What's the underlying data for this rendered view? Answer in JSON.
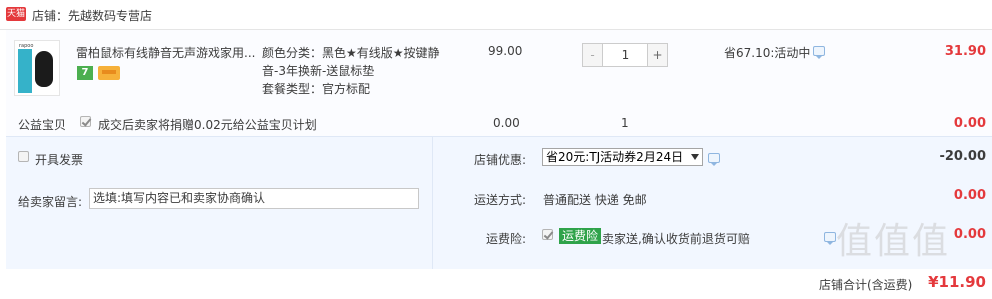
{
  "shop": {
    "badge": "天猫",
    "name": "店铺：先越数码专营店"
  },
  "item": {
    "title": "雷柏鼠标有线静音无声游戏家用...",
    "thumb_brand": "rapoo",
    "sku_lines": [
      "颜色分类：黑色★有线版★按键静",
      "音-3年换新-送鼠标垫",
      "套餐类型：官方标配"
    ],
    "unit_price": "99.00",
    "quantity": "1",
    "qty_minus": "-",
    "qty_plus": "+",
    "promo": "省67.10:活动中",
    "subtotal": "31.90"
  },
  "welfare": {
    "label": "公益宝贝",
    "text": "成交后卖家将捐赠0.02元给公益宝贝计划",
    "price": "0.00",
    "qty": "1",
    "total": "0.00"
  },
  "invoice": {
    "label": "开具发票"
  },
  "discount": {
    "label": "店铺优惠:",
    "selected": "省20元:TJ活动券2月24日",
    "amount": "-20.00"
  },
  "message": {
    "label": "给卖家留言:",
    "placeholder": "选填:填写内容已和卖家协商确认"
  },
  "shipping": {
    "label": "运送方式:",
    "value": "普通配送 快递 免邮",
    "cost": "0.00"
  },
  "insurance": {
    "label": "运费险:",
    "tag": "运费险",
    "text": "卖家送,确认收货前退货可赔",
    "cost": "0.00"
  },
  "total": {
    "label": "店铺合计(含运费)",
    "amount": "¥11.90"
  },
  "watermark": "值值值"
}
